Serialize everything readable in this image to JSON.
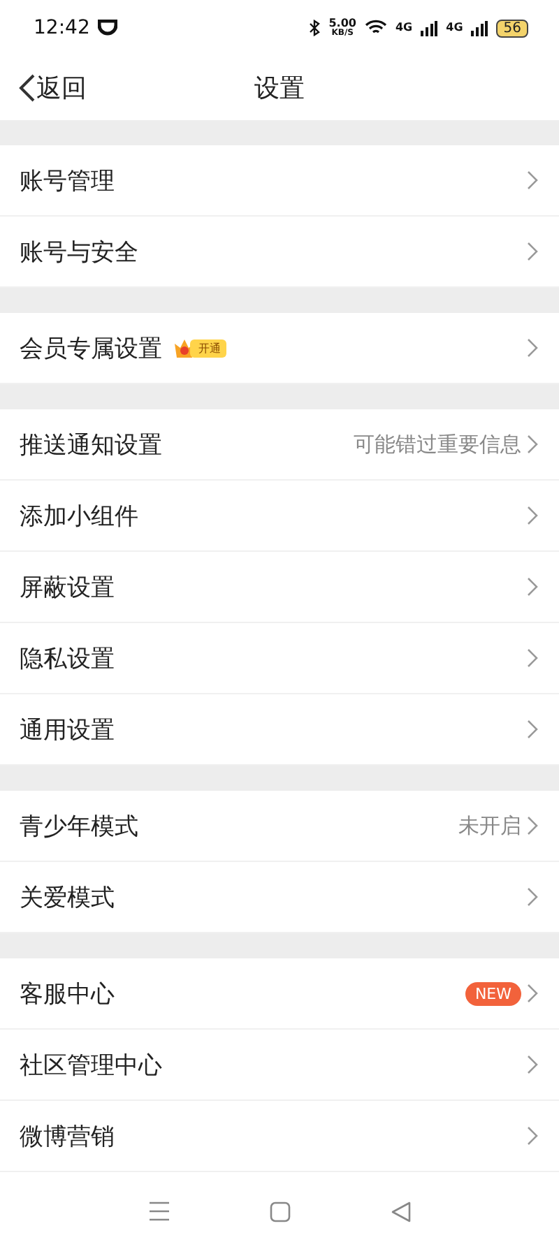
{
  "status_bar": {
    "time": "12:42",
    "speed": "5.00",
    "speed_unit": "KB/S",
    "network_1": "4G",
    "network_2": "4G",
    "battery": "56"
  },
  "nav": {
    "back": "返回",
    "title": "设置"
  },
  "groups": [
    {
      "items": [
        {
          "label": "账号管理"
        },
        {
          "label": "账号与安全"
        }
      ]
    },
    {
      "items": [
        {
          "label": "会员专属设置",
          "badge": {
            "kind": "vip",
            "text": "开通"
          }
        }
      ]
    },
    {
      "items": [
        {
          "label": "推送通知设置",
          "hint": "可能错过重要信息"
        },
        {
          "label": "添加小组件"
        },
        {
          "label": "屏蔽设置"
        },
        {
          "label": "隐私设置"
        },
        {
          "label": "通用设置"
        }
      ]
    },
    {
      "items": [
        {
          "label": "青少年模式",
          "hint": "未开启"
        },
        {
          "label": "关爱模式"
        }
      ]
    },
    {
      "items": [
        {
          "label": "客服中心",
          "badge": {
            "kind": "new",
            "text": "NEW"
          }
        },
        {
          "label": "社区管理中心"
        },
        {
          "label": "微博营销"
        }
      ]
    }
  ]
}
